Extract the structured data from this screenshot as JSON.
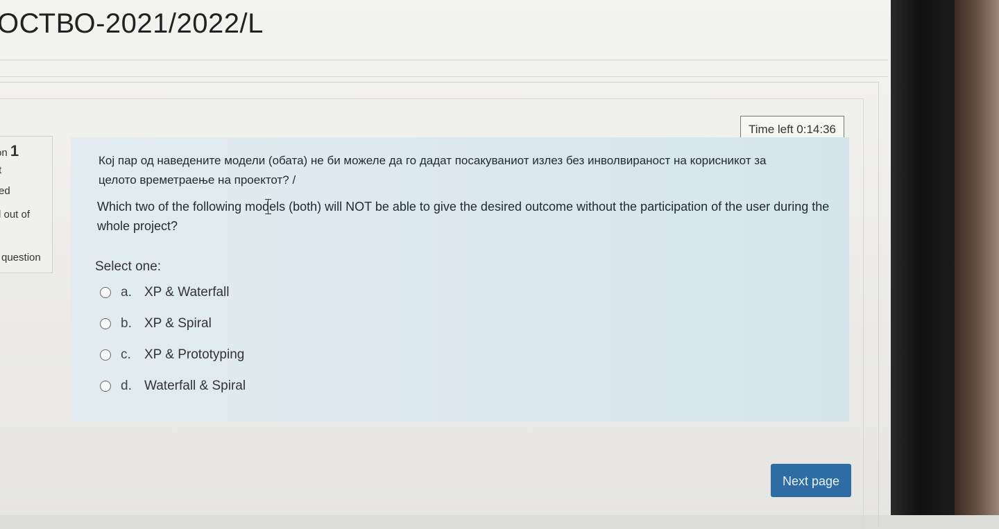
{
  "header": {
    "course_title": "ОСТВО-2021/2022/L"
  },
  "timer": {
    "text": "Time left 0:14:36"
  },
  "question_info": {
    "number_prefix": "on",
    "number": "1",
    "status_fragment": "t",
    "state_fragment": "ed",
    "marks_fragment": "l out of",
    "flag_fragment": "question"
  },
  "question": {
    "text_mk": "Кој пар од наведените модели (обата) не би можеле да го дадат посакуваниот излез без инволвираност на корисникот за целото времетраење на проектот? /",
    "text_en": "Which two of the following models (both) will NOT be able to give the desired outcome without the participation of the user during the whole project?",
    "prompt": "Select one:",
    "options": [
      {
        "letter": "a.",
        "label": "XP & Waterfall"
      },
      {
        "letter": "b.",
        "label": "XP & Spiral"
      },
      {
        "letter": "c.",
        "label": "XP & Prototyping"
      },
      {
        "letter": "d.",
        "label": "Waterfall & Spiral"
      }
    ]
  },
  "navigation": {
    "next_label": "Next page"
  },
  "colors": {
    "content_background": "#dbe8ee",
    "next_button": "#2e6da4"
  }
}
